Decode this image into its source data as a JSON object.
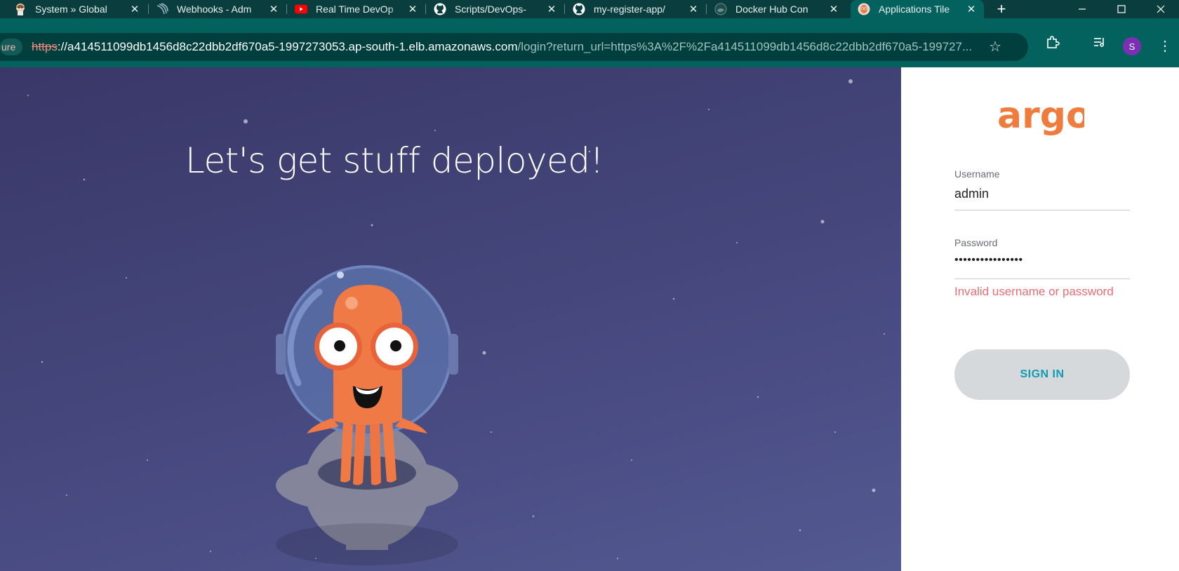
{
  "browser": {
    "tabs": [
      {
        "title": "System » Global",
        "favicon": "jenkins-butler-icon"
      },
      {
        "title": "Webhooks - Adm",
        "favicon": "webhook-icon"
      },
      {
        "title": "Real Time DevOp",
        "favicon": "youtube-icon"
      },
      {
        "title": "Scripts/DevOps-",
        "favicon": "github-icon"
      },
      {
        "title": "my-register-app/",
        "favicon": "github-icon"
      },
      {
        "title": "Docker Hub Con",
        "favicon": "docker-icon"
      },
      {
        "title": "Applications Tile",
        "favicon": "argo-icon",
        "active": true
      }
    ],
    "security_chip": "ure",
    "url_scheme": "https",
    "url_host": "://a414511099db1456d8c22dbb2df670a5-1997273053.ap-south-1.elb.amazonaws.com",
    "url_path": "/login?return_url=https%3A%2F%2Fa414511099db1456d8c22dbb2df670a5-199727...",
    "profile_initial": "S",
    "colors": {
      "tabbar": "#0a3d3d",
      "toolbar": "#04625e",
      "omnibox": "#003f3d"
    }
  },
  "hero": {
    "title": "Let's get stuff deployed!"
  },
  "login": {
    "logo_text": "argo",
    "username_label": "Username",
    "username_value": "admin",
    "password_label": "Password",
    "password_value": "••••••••••••••••",
    "error_text": "Invalid username or password",
    "signin_label": "SIGN IN",
    "colors": {
      "brand": "#ef7b3c",
      "error": "#e96d76",
      "button_text": "#0f9bb3",
      "button_bg": "#d6d9dc"
    }
  }
}
